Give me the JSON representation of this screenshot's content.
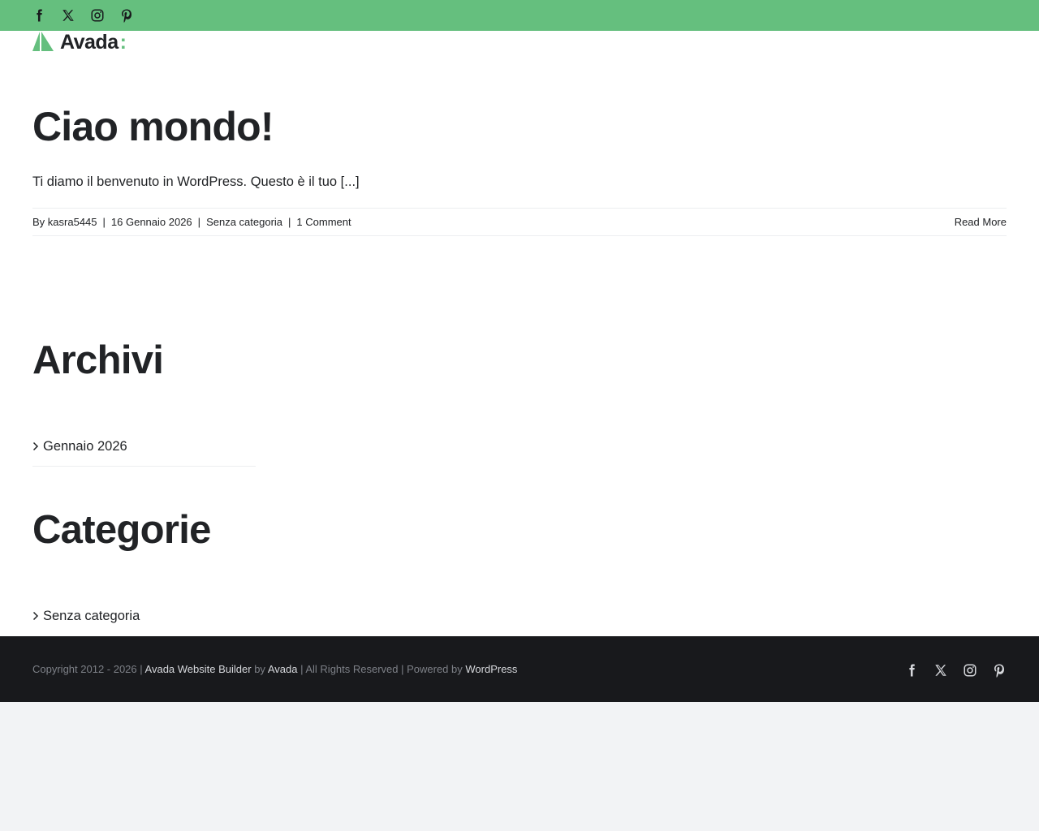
{
  "topbar": {
    "color": "#65bf7e",
    "social_icons": [
      "facebook-icon",
      "x-icon",
      "instagram-icon",
      "pinterest-icon"
    ]
  },
  "logo": {
    "text": "Avada",
    "colon": ":",
    "accent_color": "#65bf7e"
  },
  "post": {
    "title": "Ciao mondo!",
    "excerpt": "Ti diamo il benvenuto in WordPress. Questo è il tuo [...]",
    "meta": {
      "author_prefix": "By ",
      "author": "kasra5445",
      "separator": "|",
      "date": "16 Gennaio 2026",
      "category": "Senza categoria",
      "comments": "1 Comment",
      "read_more": "Read More"
    }
  },
  "widgets": {
    "archives": {
      "title": "Archivi",
      "items": [
        "Gennaio 2026"
      ]
    },
    "categories": {
      "title": "Categorie",
      "items": [
        "Senza categoria"
      ]
    }
  },
  "footer": {
    "copyright_prefix": "Copyright 2012 - 2026 | ",
    "builder_link": "Avada Website Builder",
    "by": " by ",
    "avada_link": "Avada",
    "rights": " | All Rights Reserved | Powered by ",
    "wordpress_link": "WordPress",
    "social_icons": [
      "facebook-icon",
      "x-icon",
      "instagram-icon",
      "pinterest-icon"
    ],
    "background": "#18191c"
  }
}
